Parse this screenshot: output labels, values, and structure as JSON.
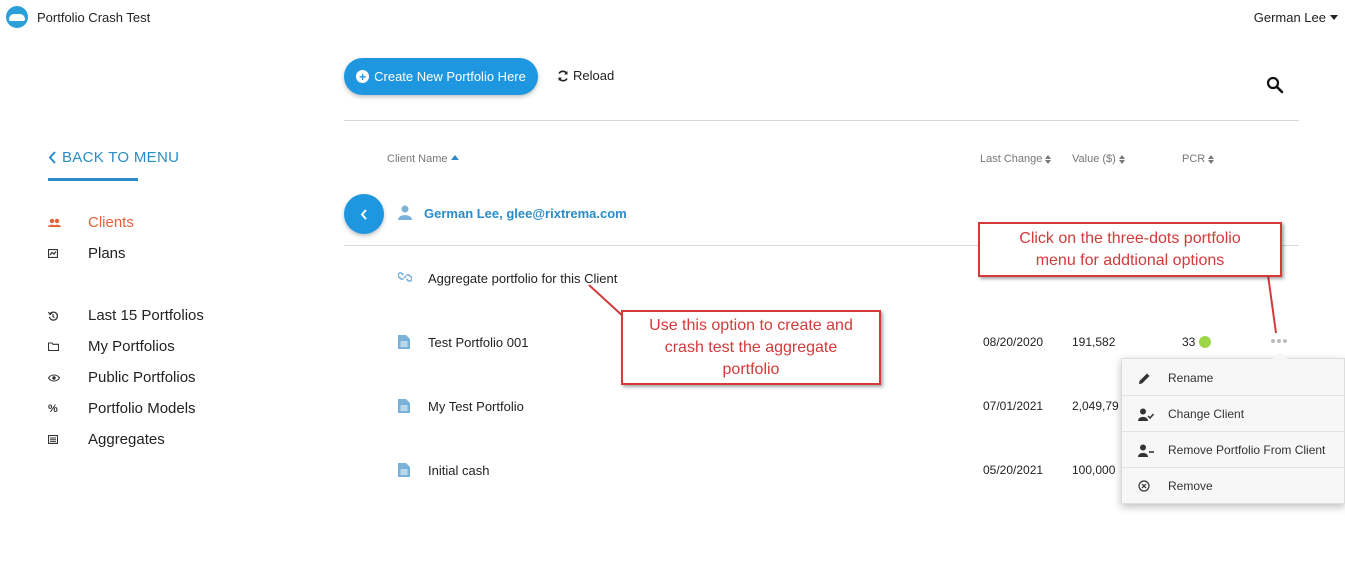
{
  "app": {
    "title": "Portfolio Crash Test"
  },
  "user": {
    "name": "German Lee"
  },
  "sidebar": {
    "back_label": "BACK TO MENU",
    "items": [
      {
        "label": "Clients",
        "icon": "users-icon",
        "active": true
      },
      {
        "label": "Plans",
        "icon": "plans-icon",
        "active": false
      },
      {
        "label": "Last 15 Portfolios",
        "icon": "history-icon",
        "active": false
      },
      {
        "label": "My Portfolios",
        "icon": "folder-icon",
        "active": false
      },
      {
        "label": "Public Portfolios",
        "icon": "eye-icon",
        "active": false
      },
      {
        "label": "Portfolio Models",
        "icon": "percent-icon",
        "active": false
      },
      {
        "label": "Aggregates",
        "icon": "list-icon",
        "active": false
      }
    ]
  },
  "toolbar": {
    "create_label": "Create New Portfolio Here",
    "reload_label": "Reload"
  },
  "table": {
    "headers": {
      "client_name": "Client Name",
      "last_change": "Last Change",
      "value": "Value ($)",
      "pcr": "PCR"
    },
    "client": {
      "label": "German Lee, glee@rixtrema.com"
    },
    "rows": [
      {
        "name": "Aggregate portfolio for this Client",
        "icon": "link-icon",
        "date": "",
        "value": "",
        "pcr": ""
      },
      {
        "name": "Test Portfolio 001",
        "icon": "document-icon",
        "date": "08/20/2020",
        "value": "191,582",
        "pcr": "33"
      },
      {
        "name": "My Test Portfolio",
        "icon": "document-icon",
        "date": "07/01/2021",
        "value": "2,049,79",
        "pcr": ""
      },
      {
        "name": "Initial cash",
        "icon": "document-icon",
        "date": "05/20/2021",
        "value": "100,000",
        "pcr": ""
      }
    ]
  },
  "context_menu": {
    "items": [
      {
        "label": "Rename",
        "icon": "pencil-icon"
      },
      {
        "label": "Change Client",
        "icon": "user-check-icon"
      },
      {
        "label": "Remove Portfolio From Client",
        "icon": "user-minus-icon"
      },
      {
        "label": "Remove",
        "icon": "remove-circle-icon"
      }
    ]
  },
  "callouts": {
    "aggregate": {
      "line1": "Use this option to create and",
      "line2": "crash test the aggregate",
      "line3": "portfolio"
    },
    "dots": {
      "line1": "Click on the three-dots portfolio",
      "line2": "menu for addtional options"
    }
  },
  "colors": {
    "primary": "#1f97e0",
    "link": "#2a8cc8",
    "active": "#e2623a",
    "callout": "#d33a3a",
    "pcr_good": "#9ed64a"
  }
}
